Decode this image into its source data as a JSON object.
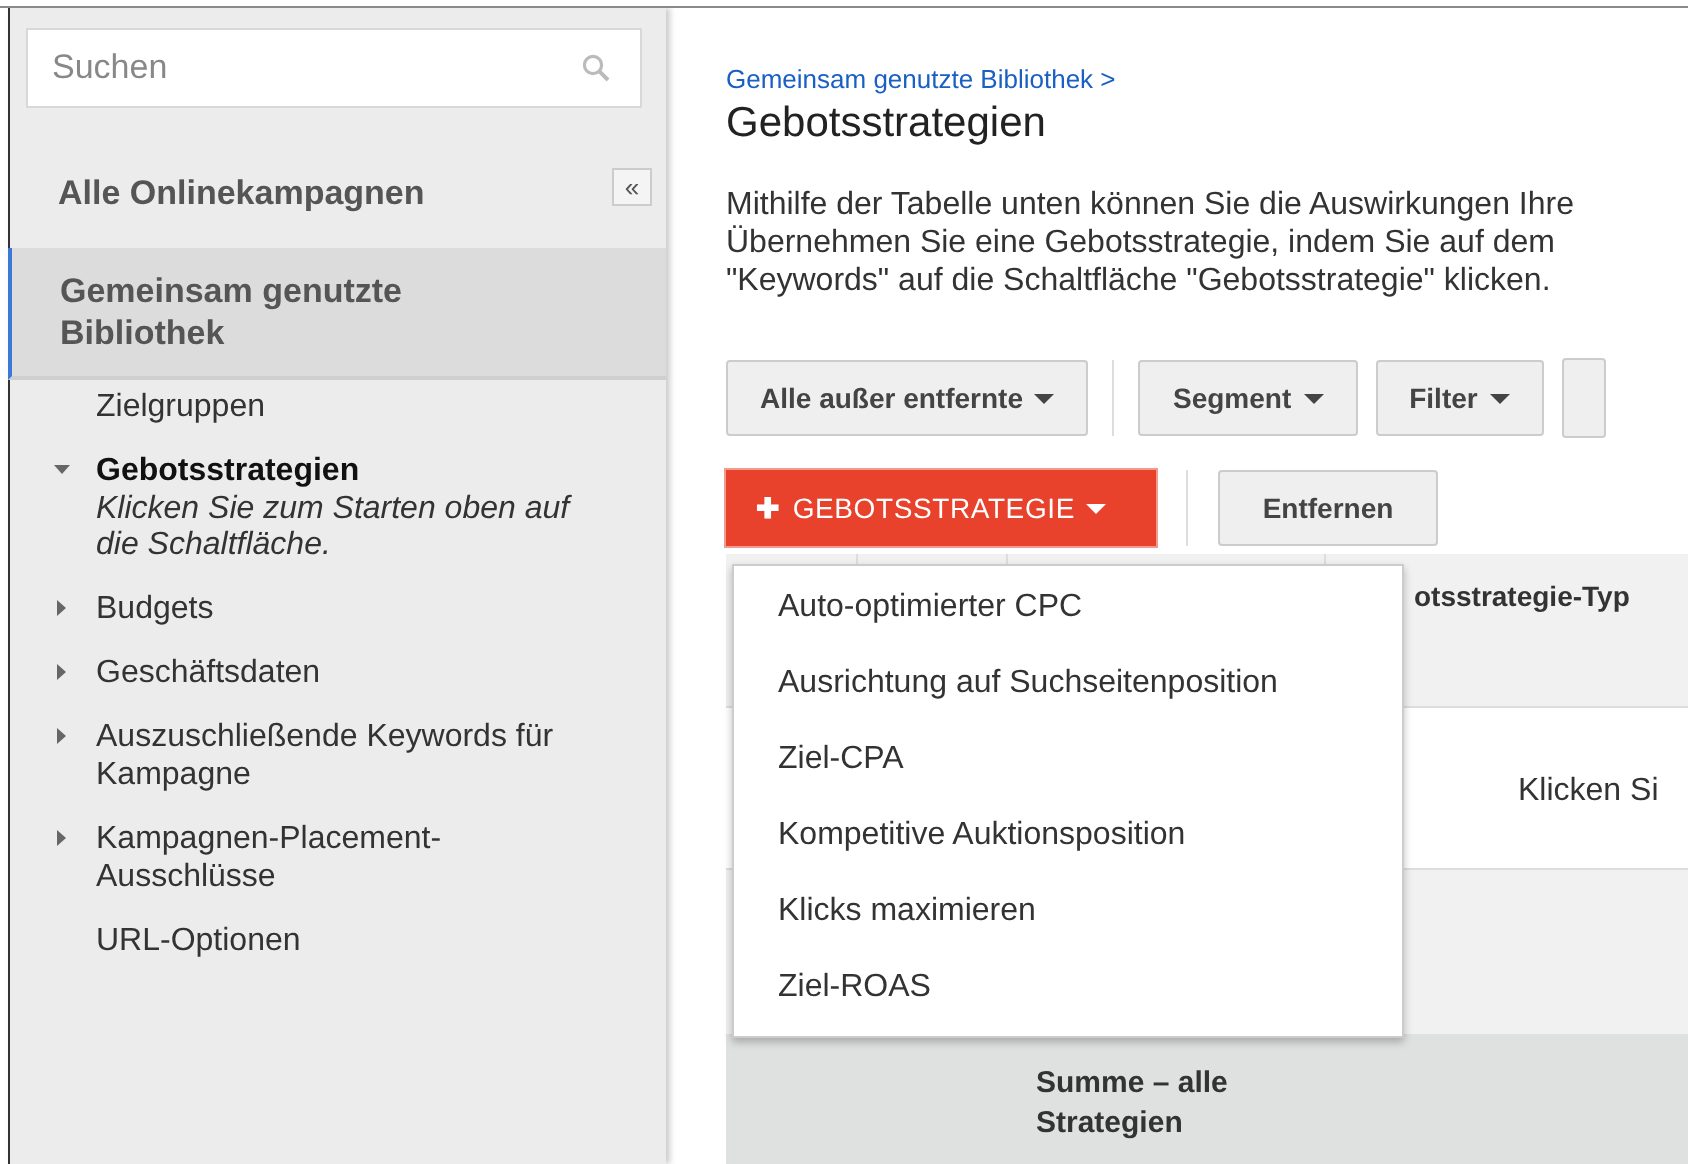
{
  "sidebar": {
    "search": {
      "placeholder": "Suchen"
    },
    "section_title": "Alle Onlinekampagnen",
    "collapse_button": "«",
    "library_item": {
      "label": "Gemeinsam genutzte Bibliothek",
      "selected": true
    },
    "items": [
      {
        "label": "Zielgruppen",
        "kind": "leaf",
        "selected": false
      },
      {
        "label": "Gebotsstrategien",
        "kind": "folder",
        "expanded": true,
        "selected": true,
        "hint": "Klicken Sie zum Starten oben auf die Schaltfläche."
      },
      {
        "label": "Budgets",
        "kind": "folder",
        "expanded": false,
        "selected": false
      },
      {
        "label": "Geschäftsdaten",
        "kind": "folder",
        "expanded": false,
        "selected": false
      },
      {
        "label": "Auszuschließende Keywords für Kampagne",
        "kind": "folder",
        "expanded": false,
        "selected": false
      },
      {
        "label": "Kampagnen-Placement-Ausschlüsse",
        "kind": "folder",
        "expanded": false,
        "selected": false
      },
      {
        "label": "URL-Optionen",
        "kind": "leaf",
        "selected": false
      }
    ]
  },
  "breadcrumb": "Gemeinsam genutzte Bibliothek >",
  "title": "Gebotsstrategien",
  "description": [
    "Mithilfe der Tabelle unten können Sie die Auswirkungen Ihre",
    "Übernehmen Sie eine Gebotsstrategie, indem Sie auf dem",
    "\"Keywords\" auf die Schaltfläche \"Gebotsstrategie\" klicken."
  ],
  "toolbar": [
    {
      "label": "Alle außer entfernte",
      "dropdown": true
    },
    {
      "label": "Segment",
      "dropdown": true
    },
    {
      "label": "Filter",
      "dropdown": true
    }
  ],
  "add_button": {
    "label": "GEBOTSSTRATEGIE",
    "plus": "✚"
  },
  "remove_button": "Entfernen",
  "add_menu": [
    "Auto-optimierter CPC",
    "Ausrichtung auf Suchseitenposition",
    "Ziel-CPA",
    "Kompetitive Auktionsposition",
    "Klicks maximieren",
    "Ziel-ROAS"
  ],
  "table": {
    "header": "otsstrategie-Typ",
    "row_1": "Klicken Si",
    "total": "Summe – alle Strategien"
  }
}
